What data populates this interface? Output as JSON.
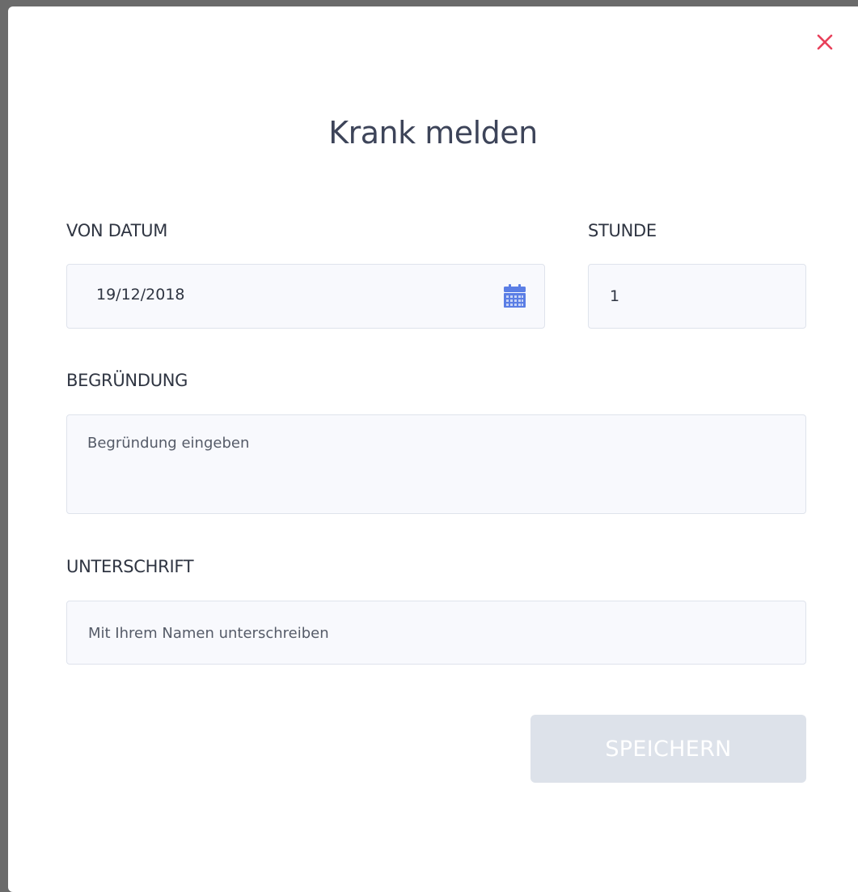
{
  "dialog": {
    "title": "Krank melden",
    "close_icon": "close-icon",
    "accent_close": "#e8405a"
  },
  "form": {
    "from_date": {
      "label": "VON DATUM",
      "value": "19/12/2018",
      "icon": "calendar-icon"
    },
    "hour": {
      "label": "STUNDE",
      "value": "1"
    },
    "reason": {
      "label": "BEGRÜNDUNG",
      "placeholder": "Begründung eingeben"
    },
    "signature": {
      "label": "UNTERSCHRIFT",
      "placeholder": "Mit Ihrem Namen unterschreiben"
    }
  },
  "actions": {
    "save_label": "SPEICHERN"
  }
}
